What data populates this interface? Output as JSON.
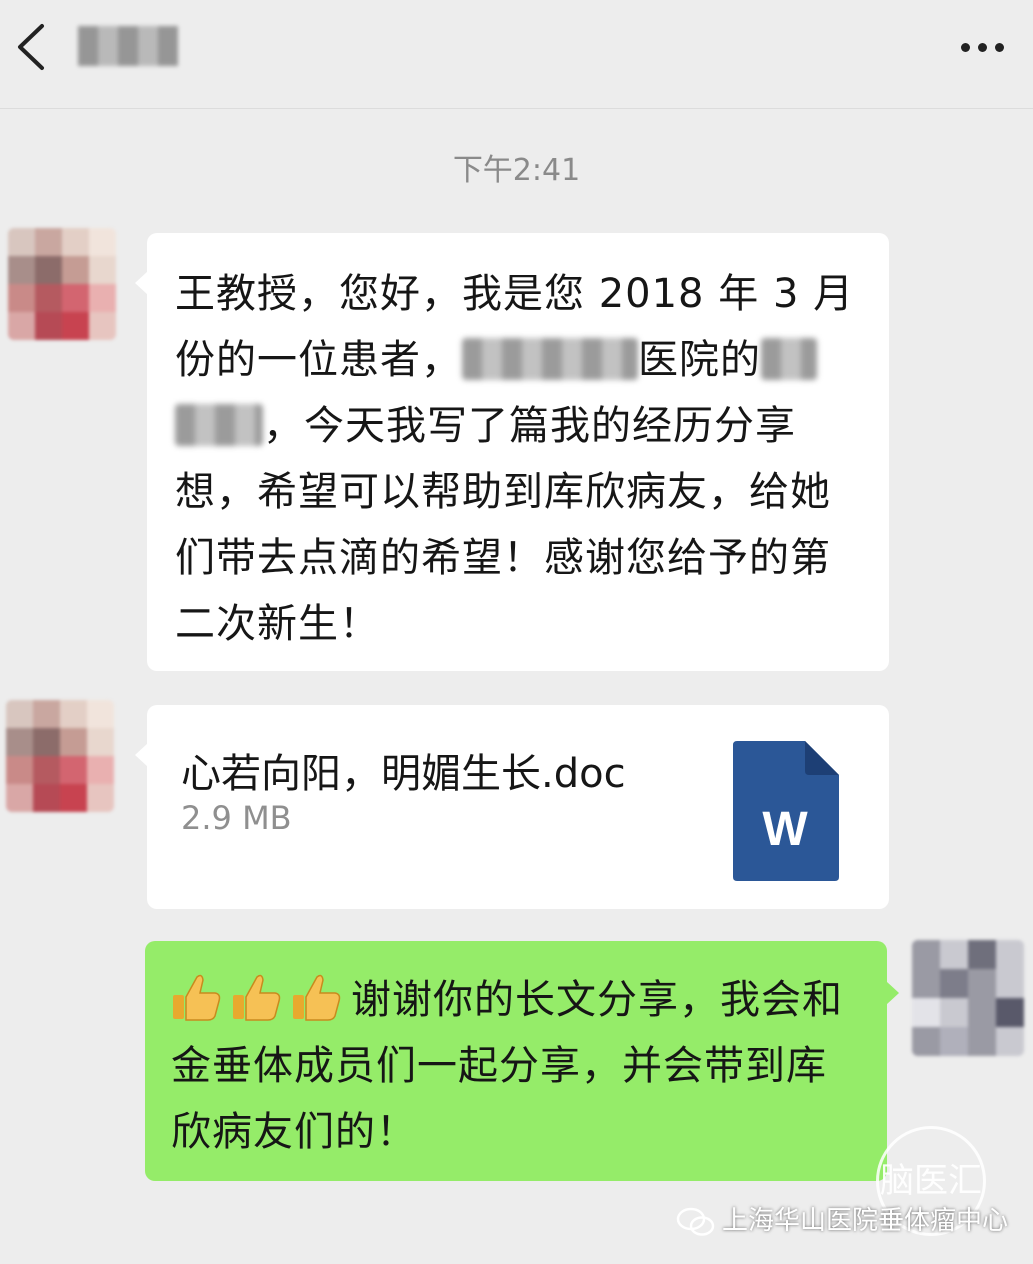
{
  "header": {
    "back_icon": "chevron-left-icon",
    "contact_name_blurred": "",
    "more_icon": "more-dots-icon"
  },
  "timestamp": "下午2:41",
  "messages": [
    {
      "side": "left",
      "segments": {
        "s1": "王教授，您好，我是您 2018 年 3 月份的一位患者，",
        "s2": "医院的",
        "s3": "，今天我写了篇我的经历分享想，希望可以帮助到库欣病友，给她们带去点滴的希望！感谢您给予的第二次新生！"
      }
    },
    {
      "side": "left",
      "file": {
        "name": "心若向阳，明媚生长.doc",
        "size": "2.9 MB",
        "icon_letter": "W",
        "icon_color": "#2b5797"
      }
    },
    {
      "side": "right",
      "emoji": "thumbs-up-icon",
      "text": "谢谢你的长文分享，我会和金垂体成员们一起分享，并会带到库欣病友们的！"
    }
  ],
  "watermark": {
    "logo_text": "脑医汇",
    "caption": "上海华山医院垂体瘤中心",
    "icon": "wechat-icon"
  },
  "colors": {
    "background": "#ededed",
    "bubble_left": "#ffffff",
    "bubble_right": "#95ec69"
  }
}
